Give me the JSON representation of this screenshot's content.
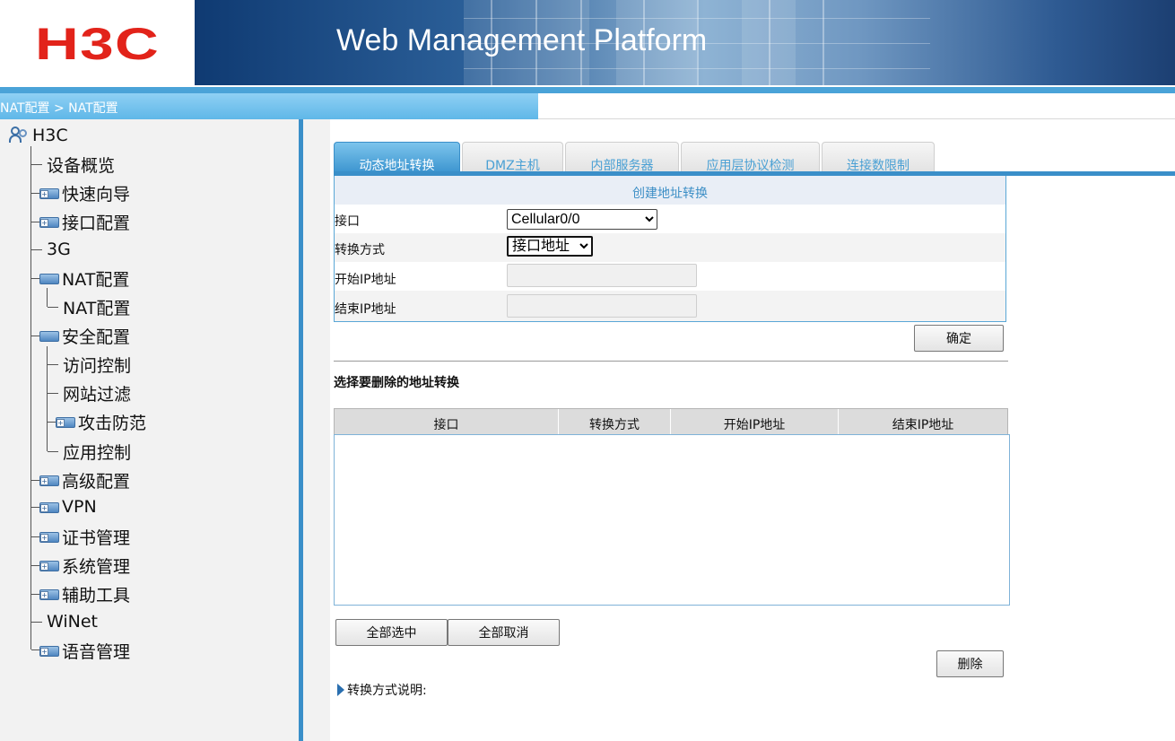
{
  "header": {
    "logo_text": "H3C",
    "platform_title": "Web Management Platform"
  },
  "breadcrumb": "NAT配置 > NAT配置",
  "sidebar": {
    "root_label": "H3C",
    "items": [
      {
        "label": "设备概览",
        "type": "leaf"
      },
      {
        "label": "快速向导",
        "type": "folder"
      },
      {
        "label": "接口配置",
        "type": "folder"
      },
      {
        "label": "3G",
        "type": "leaf"
      },
      {
        "label": "NAT配置",
        "type": "folder-open"
      },
      {
        "label": "NAT配置",
        "type": "leaf"
      },
      {
        "label": "安全配置",
        "type": "folder-open"
      },
      {
        "label": "访问控制",
        "type": "leaf"
      },
      {
        "label": "网站过滤",
        "type": "leaf"
      },
      {
        "label": "攻击防范",
        "type": "folder"
      },
      {
        "label": "应用控制",
        "type": "leaf"
      },
      {
        "label": "高级配置",
        "type": "folder"
      },
      {
        "label": "VPN",
        "type": "folder"
      },
      {
        "label": "证书管理",
        "type": "folder"
      },
      {
        "label": "系统管理",
        "type": "folder"
      },
      {
        "label": "辅助工具",
        "type": "folder"
      },
      {
        "label": "WiNet",
        "type": "leaf"
      },
      {
        "label": "语音管理",
        "type": "folder"
      }
    ]
  },
  "tabs": [
    "动态地址转换",
    "DMZ主机",
    "内部服务器",
    "应用层协议检测",
    "连接数限制"
  ],
  "create": {
    "title": "创建地址转换",
    "interface_label": "接口",
    "interface_value": "Cellular0/0",
    "mode_label": "转换方式",
    "mode_value": "接口地址",
    "start_ip_label": "开始IP地址",
    "end_ip_label": "结束IP地址",
    "confirm_button": "确定"
  },
  "delete": {
    "title": "选择要删除的地址转换",
    "columns": [
      "接口",
      "转换方式",
      "开始IP地址",
      "结束IP地址"
    ],
    "select_all_button": "全部选中",
    "deselect_all_button": "全部取消",
    "delete_button": "删除"
  },
  "explain_label": "转换方式说明:",
  "colors": {
    "accent_blue": "#3a8fc9",
    "logo_red": "#e2231a",
    "tab_text": "#4aa0d4"
  }
}
